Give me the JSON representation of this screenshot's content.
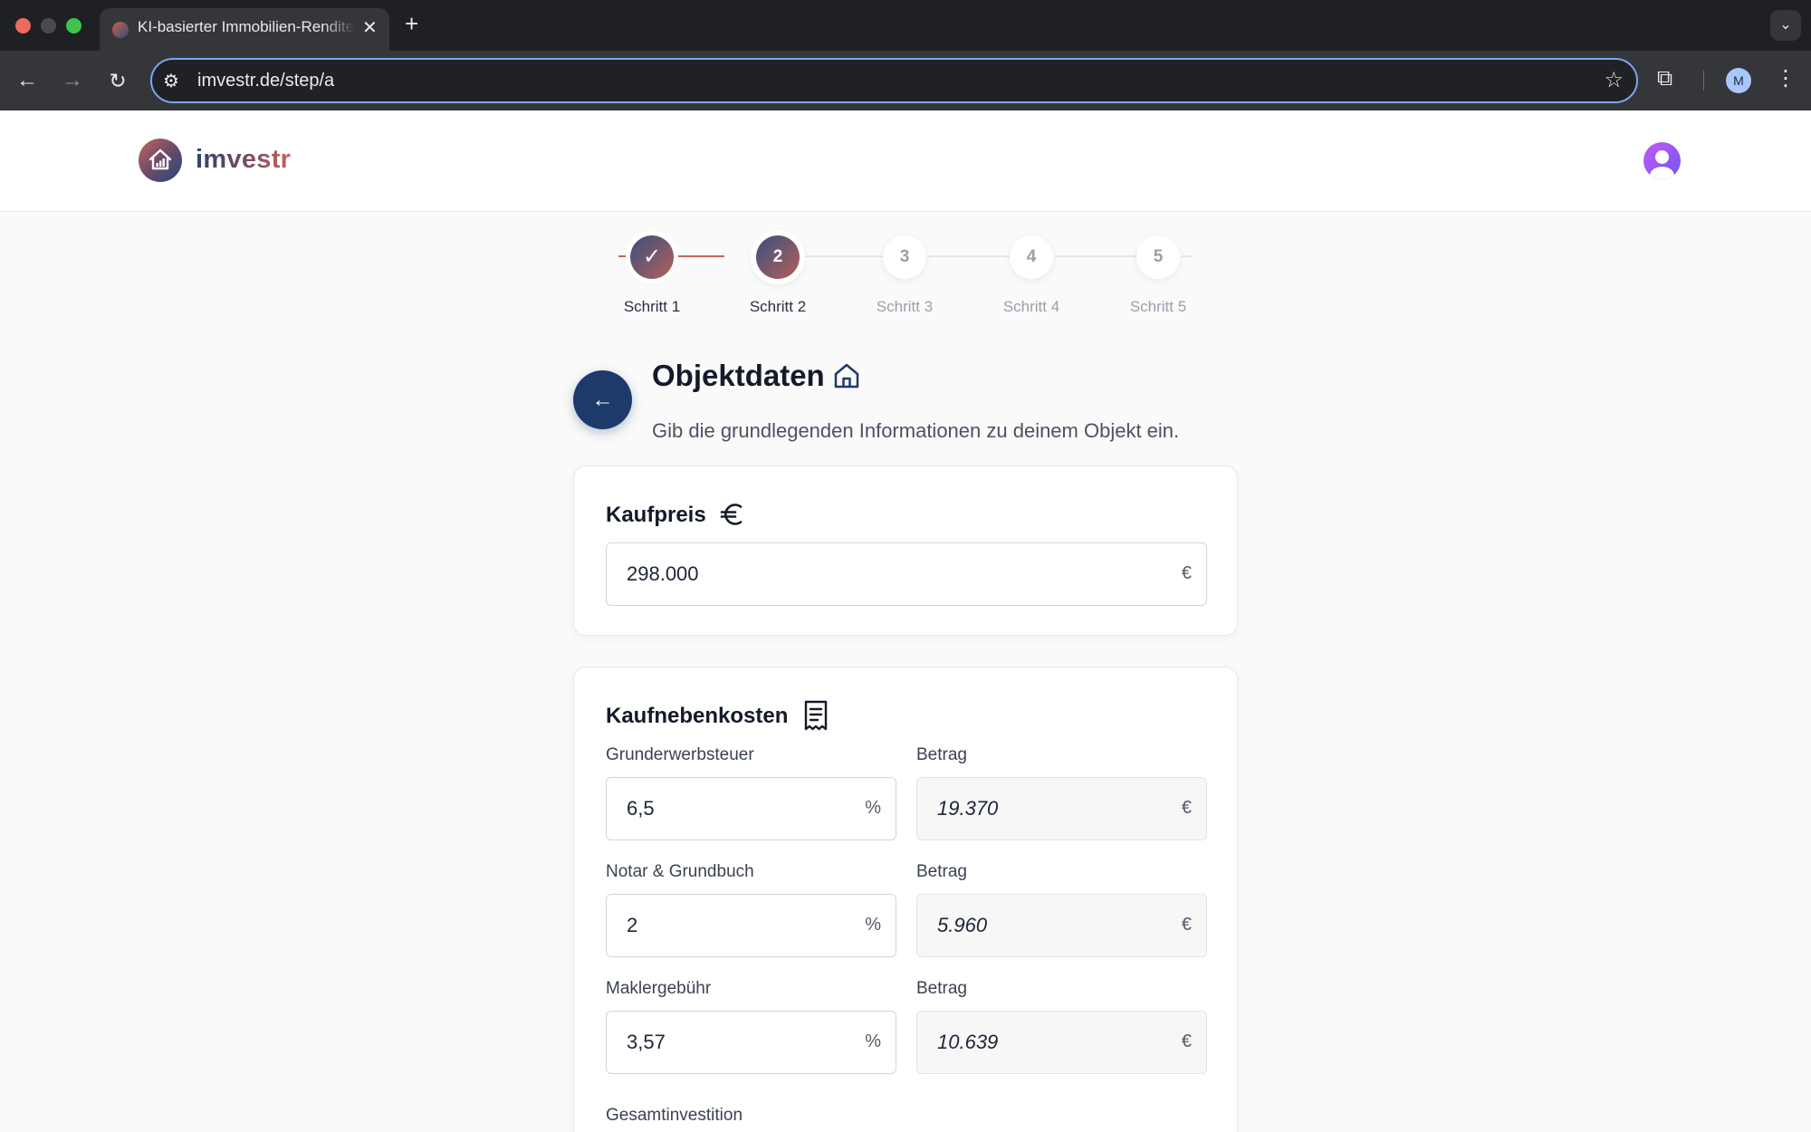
{
  "browser": {
    "tab_title": "KI-basierter Immobilien-Rendite",
    "url": "imvestr.de/step/a",
    "profile_initial": "M"
  },
  "app": {
    "brand": "imvestr"
  },
  "stepper": {
    "steps": [
      {
        "number": "1",
        "label": "Schritt 1",
        "state": "complete"
      },
      {
        "number": "2",
        "label": "Schritt 2",
        "state": "active"
      },
      {
        "number": "3",
        "label": "Schritt 3",
        "state": "pending"
      },
      {
        "number": "4",
        "label": "Schritt 4",
        "state": "pending"
      },
      {
        "number": "5",
        "label": "Schritt 5",
        "state": "pending"
      }
    ]
  },
  "page": {
    "title": "Objektdaten",
    "subtitle": "Gib die grundlegenden Informationen zu deinem Objekt ein."
  },
  "kaufpreis": {
    "title": "Kaufpreis",
    "value": "298.000",
    "unit": "€"
  },
  "kaufnebenkosten": {
    "title": "Kaufnebenkosten",
    "amount_label": "Betrag",
    "rows": [
      {
        "label": "Grunderwerbsteuer",
        "percent": "6,5",
        "percent_unit": "%",
        "amount": "19.370",
        "amount_unit": "€"
      },
      {
        "label": "Notar & Grundbuch",
        "percent": "2",
        "percent_unit": "%",
        "amount": "5.960",
        "amount_unit": "€"
      },
      {
        "label": "Maklergebühr",
        "percent": "3,57",
        "percent_unit": "%",
        "amount": "10.639",
        "amount_unit": "€"
      }
    ],
    "total_label": "Gesamtinvestition"
  },
  "colors": {
    "primary_navy": "#1e3a6b",
    "accent_coral": "#c4655a",
    "avatar_purple": "#8b5cf6"
  },
  "icons": {
    "title": "home-icon",
    "kaufpreis": "euro-icon",
    "kaufnebenkosten": "receipt-icon",
    "back": "arrow-left-icon"
  }
}
